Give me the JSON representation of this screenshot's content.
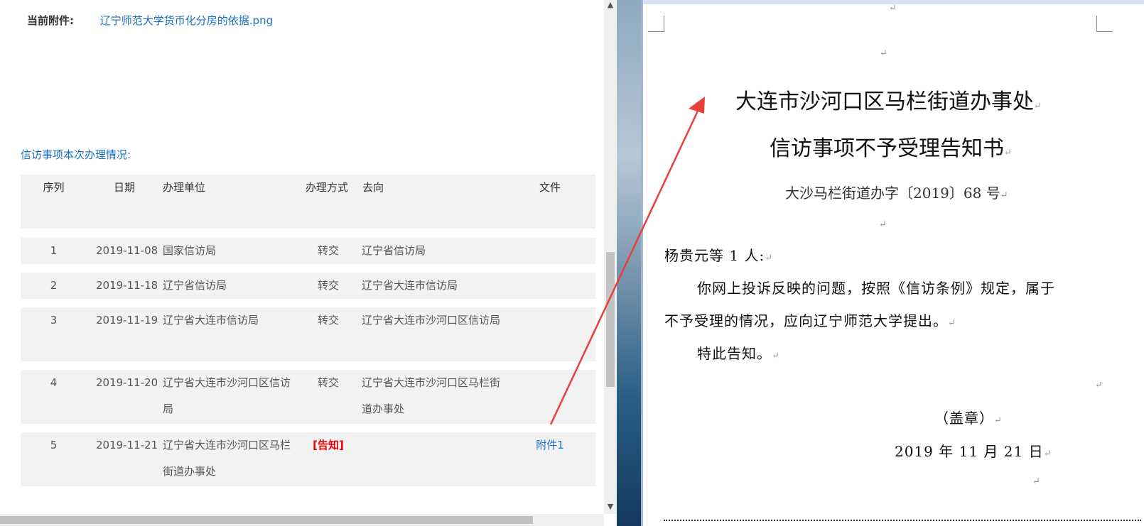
{
  "attachment": {
    "label": "当前附件:",
    "file_name": "辽宁师范大学货币化分房的依据.png"
  },
  "section_title": "信访事项本次办理情况:",
  "table": {
    "headers": {
      "seq": "序列",
      "date": "日期",
      "unit": "办理单位",
      "mode": "办理方式",
      "dest": "去向",
      "file": "文件"
    },
    "rows": [
      {
        "seq": "1",
        "date": "2019-11-08",
        "unit": "国家信访局",
        "mode": "转交",
        "dest": "辽宁省信访局",
        "file": ""
      },
      {
        "seq": "2",
        "date": "2019-11-18",
        "unit": "辽宁省信访局",
        "mode": "转交",
        "dest": "辽宁省大连市信访局",
        "file": ""
      },
      {
        "seq": "3",
        "date": "2019-11-19",
        "unit": "辽宁省大连市信访局",
        "mode": "转交",
        "dest": "辽宁省大连市沙河口区信访局",
        "file": ""
      },
      {
        "seq": "4",
        "date": "2019-11-20",
        "unit": "辽宁省大连市沙河口区信访局",
        "mode": "转交",
        "dest": "辽宁省大连市沙河口区马栏街道办事处",
        "file": ""
      },
      {
        "seq": "5",
        "date": "2019-11-21",
        "unit": "辽宁省大连市沙河口区马栏街道办事处",
        "mode": "[告知]",
        "dest": "",
        "file": "附件1"
      }
    ]
  },
  "document": {
    "title_line1": "大连市沙河口区马栏街道办事处",
    "title_line2": "信访事项不予受理告知书",
    "doc_number": "大沙马栏街道办字〔2019〕68 号",
    "addressee": "杨贵元等 1 人:",
    "body_line1": "你网上投诉反映的问题，按照《信访条例》规定，属于",
    "body_line2": "不予受理的情况，应向辽宁师范大学提出。",
    "closing": "特此告知。",
    "seal": "（盖章）",
    "date": "2019 年 11 月 21 日",
    "paragraph_mark": "↵"
  },
  "colors": {
    "link": "#1a6fc0",
    "notice": "#ee0000",
    "arrow": "#e8413c"
  }
}
